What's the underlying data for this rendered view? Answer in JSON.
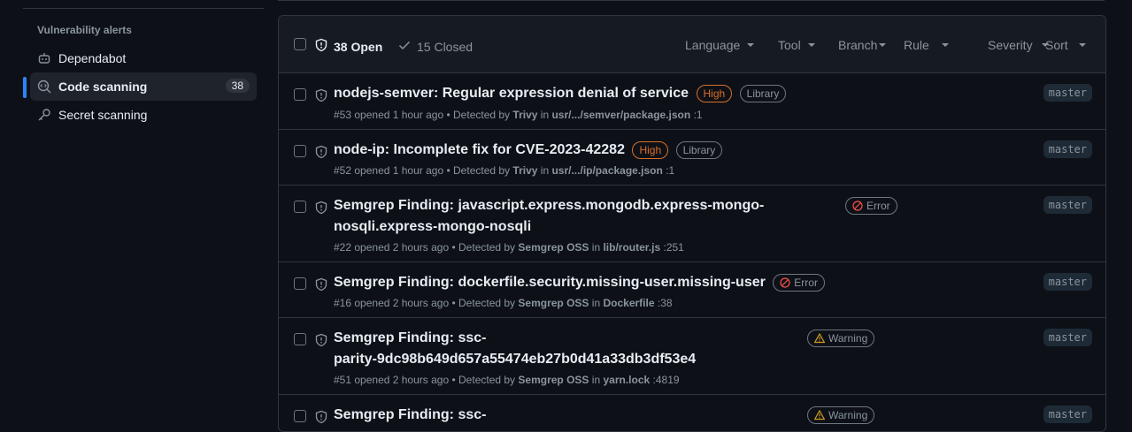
{
  "sidebar": {
    "heading": "Vulnerability alerts",
    "items": [
      {
        "label": "Dependabot",
        "icon": "robot-icon"
      },
      {
        "label": "Code scanning",
        "icon": "codescan-icon",
        "count": "38",
        "active": true
      },
      {
        "label": "Secret scanning",
        "icon": "key-icon"
      }
    ]
  },
  "header": {
    "open_label": "38 Open",
    "closed_label": "15 Closed",
    "filters": [
      "Language",
      "Tool",
      "Branch",
      "Rule",
      "Severity",
      "Sort"
    ]
  },
  "alerts": [
    {
      "title": "nodejs-semver: Regular expression denial of service",
      "labels": [
        "High",
        "Library"
      ],
      "number": "#53",
      "opened": "opened 1 hour ago",
      "detected_by": "Detected by",
      "tool": "Trivy",
      "in": "in",
      "path": "usr/.../semver/package.json",
      "line": ":1",
      "branch": "master"
    },
    {
      "title": "node-ip: Incomplete fix for CVE-2023-42282",
      "labels": [
        "High",
        "Library"
      ],
      "number": "#52",
      "opened": "opened 1 hour ago",
      "detected_by": "Detected by",
      "tool": "Trivy",
      "in": "in",
      "path": "usr/.../ip/package.json",
      "line": ":1",
      "branch": "master"
    },
    {
      "title_line1": "Semgrep Finding: javascript.express.mongodb.express-mongo-",
      "title_line2": "nosqli.express-mongo-nosqli",
      "severity": "Error",
      "number": "#22",
      "opened": "opened 2 hours ago",
      "detected_by": "Detected by",
      "tool": "Semgrep OSS",
      "in": "in",
      "path": "lib/router.js",
      "line": ":251",
      "branch": "master"
    },
    {
      "title": "Semgrep Finding: dockerfile.security.missing-user.missing-user",
      "severity": "Error",
      "number": "#16",
      "opened": "opened 2 hours ago",
      "detected_by": "Detected by",
      "tool": "Semgrep OSS",
      "in": "in",
      "path": "Dockerfile",
      "line": ":38",
      "branch": "master"
    },
    {
      "title_line1": "Semgrep Finding: ssc-",
      "title_line2": "parity-9dc98b649d657a55474eb27b0d41a33db3df53e4",
      "severity": "Warning",
      "number": "#51",
      "opened": "opened 2 hours ago",
      "detected_by": "Detected by",
      "tool": "Semgrep OSS",
      "in": "in",
      "path": "yarn.lock",
      "line": ":4819",
      "branch": "master"
    },
    {
      "title_line1": "Semgrep Finding: ssc-",
      "severity": "Warning",
      "branch": "master"
    }
  ]
}
